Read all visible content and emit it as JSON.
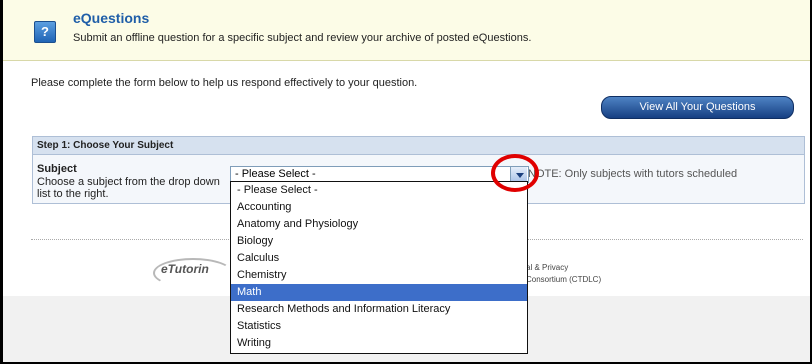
{
  "header": {
    "icon": "help-question-icon",
    "title": "eQuestions",
    "subtitle": "Submit an offline question for a specific subject and review your archive of posted eQuestions."
  },
  "intro_text": "Please complete the form below to help us respond effectively to your question.",
  "view_all_button": "View All Your Questions",
  "step1": {
    "header": "Step 1: Choose Your Subject",
    "subject_label": "Subject",
    "subject_description": "Choose a subject from the drop down list to the right.",
    "note": "NOTE: Only subjects with tutors scheduled"
  },
  "subject_select": {
    "value": "- Please Select -",
    "options": [
      "- Please Select -",
      "Accounting",
      "Anatomy and Physiology",
      "Biology",
      "Calculus",
      "Chemistry",
      "Math",
      "Research Methods and Information Literacy",
      "Statistics",
      "Writing"
    ],
    "highlighted_option": "Math"
  },
  "footer": {
    "logo_text": "eTutorin",
    "line1": "al & Privacy",
    "line2": "Consortium (CTDLC)"
  },
  "colors": {
    "accent": "#1f5ea8",
    "highlight": "#3d6ec9",
    "annotation": "#e00000"
  }
}
